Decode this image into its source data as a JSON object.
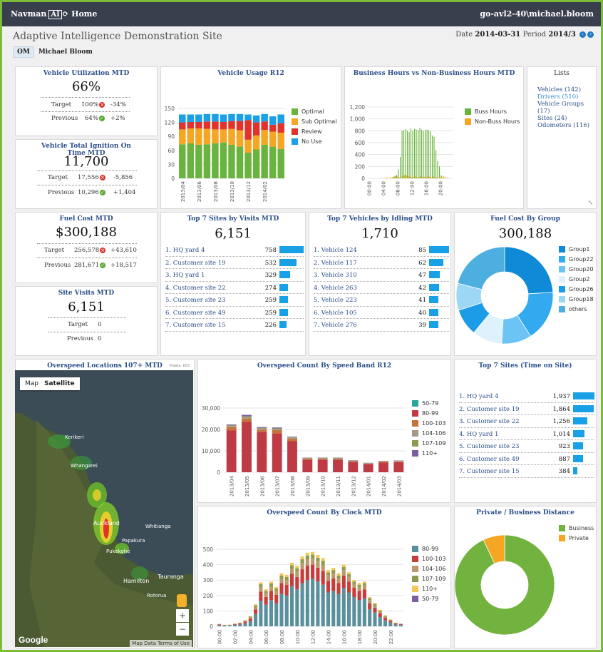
{
  "topbar": {
    "brand": "Navman",
    "brand_ai": "AI",
    "home": "Home",
    "user": "go-avl2-40\\michael.bloom"
  },
  "site_title": "Adaptive Intelligence Demonstration Site",
  "period": {
    "date_label": "Date",
    "date": "2014-03-31",
    "period_label": "Period",
    "period": "2014/3"
  },
  "user_tag": "OM",
  "user_name": "Michael Bloom",
  "vehicle_util": {
    "title": "Vehicle Utilization MTD",
    "value": "66%",
    "target_label": "Target",
    "target": "100%",
    "target_diff": "-34%",
    "previous_label": "Previous",
    "previous": "64%",
    "previous_diff": "+2%"
  },
  "ignition": {
    "title": "Vehicle Total Ignition On Time MTD",
    "value": "11,700",
    "target_label": "Target",
    "target": "17,556",
    "target_diff": "-5,856",
    "previous_label": "Previous",
    "previous": "10,296",
    "previous_diff": "+1,404"
  },
  "fuel_cost": {
    "title": "Fuel Cost MTD",
    "value": "$300,188",
    "target_label": "Target",
    "target": "256,578",
    "target_diff": "+43,610",
    "previous_label": "Previous",
    "previous": "281,671",
    "previous_diff": "+18,517"
  },
  "site_visits": {
    "title": "Site Visits MTD",
    "value": "6,151",
    "target_label": "Target",
    "target": "0",
    "previous_label": "Previous",
    "previous": "0"
  },
  "lists": {
    "title": "Lists",
    "items": [
      "Vehicles (142)",
      "Drivers (510)",
      "Vehicle Groups (17)",
      "Sites (24)",
      "Odometers (116)"
    ]
  },
  "top_sites_visits": {
    "title": "Top 7 Sites by Visits MTD",
    "total": "6,151",
    "rows": [
      {
        "name": "1. HQ yard 4",
        "value": "758",
        "frac": 1.0
      },
      {
        "name": "2. Customer site 19",
        "value": "532",
        "frac": 0.7
      },
      {
        "name": "3. HQ yard 1",
        "value": "329",
        "frac": 0.43
      },
      {
        "name": "4. Customer site 22",
        "value": "274",
        "frac": 0.36
      },
      {
        "name": "5. Customer site 23",
        "value": "259",
        "frac": 0.34
      },
      {
        "name": "6. Customer site 49",
        "value": "259",
        "frac": 0.34
      },
      {
        "name": "7. Customer site 15",
        "value": "226",
        "frac": 0.3
      }
    ]
  },
  "top_idling": {
    "title": "Top 7 Vehicles by Idling MTD",
    "total": "1,710",
    "rows": [
      {
        "name": "1. Vehicle 124",
        "value": "85",
        "frac": 1.0
      },
      {
        "name": "2. Vehicle 117",
        "value": "62",
        "frac": 0.73
      },
      {
        "name": "3. Vehicle 310",
        "value": "47",
        "frac": 0.55
      },
      {
        "name": "4. Vehicle 263",
        "value": "42",
        "frac": 0.49
      },
      {
        "name": "5. Vehicle 223",
        "value": "41",
        "frac": 0.48
      },
      {
        "name": "6. Vehicle 105",
        "value": "40",
        "frac": 0.47
      },
      {
        "name": "7. Vehicle 276",
        "value": "39",
        "frac": 0.46
      }
    ]
  },
  "top_time_on_site": {
    "title": "Top 7 Sites (Time on Site)",
    "rows": [
      {
        "name": "1. HQ yard 4",
        "value": "1,937",
        "frac": 1.0
      },
      {
        "name": "2. Customer site 19",
        "value": "1,864",
        "frac": 0.96
      },
      {
        "name": "3. Customer site 22",
        "value": "1,256",
        "frac": 0.65
      },
      {
        "name": "4. HQ yard 1",
        "value": "1,014",
        "frac": 0.52
      },
      {
        "name": "5. Customer site 23",
        "value": "923",
        "frac": 0.48
      },
      {
        "name": "6. Customer site 49",
        "value": "887",
        "frac": 0.46
      },
      {
        "name": "7. Customer site 15",
        "value": "384",
        "frac": 0.2
      }
    ]
  },
  "map": {
    "title": "Overspeed Locations 107+ MTD",
    "points": "Points: 653",
    "btn_map": "Map",
    "btn_sat": "Satellite",
    "google": "Google",
    "footer": "Map Data  Terms of Use",
    "places": [
      "Kerikeri",
      "Whangarei",
      "Auckland",
      "Whitianga",
      "Papakura",
      "Pukekohe",
      "Tauranga",
      "Hamilton",
      "Rotorua"
    ]
  },
  "chart_data": [
    {
      "id": "usage",
      "type": "bar",
      "title": "Vehicle Usage R12",
      "categories": [
        "2013/04",
        "2013/05",
        "2013/06",
        "2013/07",
        "2013/08",
        "2013/09",
        "2013/10",
        "2013/11",
        "2013/12",
        "2014/01",
        "2014/02",
        "2014/03",
        "2014/04"
      ],
      "x_tick_labels": [
        "2013/04",
        "2013/06",
        "2013/08",
        "2013/10",
        "2013/12",
        "2014/02"
      ],
      "ylim": [
        0,
        150
      ],
      "yticks": [
        0,
        30,
        60,
        90,
        120,
        150
      ],
      "colors": [
        "#6ab33e",
        "#f5a623",
        "#e0332c",
        "#1aa0e6"
      ],
      "series": [
        {
          "name": "Optimal",
          "values": [
            73,
            75,
            72,
            73,
            75,
            77,
            72,
            68,
            55,
            62,
            72,
            68,
            63
          ]
        },
        {
          "name": "Sub Optimal",
          "values": [
            32,
            32,
            35,
            33,
            30,
            28,
            34,
            35,
            28,
            30,
            32,
            32,
            35
          ]
        },
        {
          "name": "Review",
          "values": [
            15,
            14,
            14,
            16,
            17,
            16,
            17,
            20,
            42,
            28,
            18,
            15,
            20
          ]
        },
        {
          "name": "No Use",
          "values": [
            17,
            16,
            16,
            16,
            16,
            16,
            15,
            15,
            12,
            15,
            16,
            18,
            19
          ]
        }
      ]
    },
    {
      "id": "hours",
      "type": "bar",
      "title": "Business Hours vs Non-Business Hours MTD",
      "ylim": [
        0,
        1200
      ],
      "yticks": [
        0,
        200,
        400,
        600,
        800,
        1000,
        1200
      ],
      "xticks": [
        "00:00",
        "04:00",
        "08:00",
        "12:00",
        "16:00",
        "20:00"
      ],
      "colors": [
        "#6ab33e",
        "#f5a623"
      ],
      "series": [
        {
          "name": "Buss Hours",
          "values": [
            0,
            0,
            0,
            0,
            0,
            0,
            0,
            0,
            0,
            0,
            0,
            0,
            0,
            0,
            20,
            40,
            60,
            150,
            360,
            800,
            810,
            830,
            800,
            780,
            840,
            800,
            830,
            820,
            810,
            850,
            820,
            800,
            810,
            820,
            810,
            790,
            720,
            700,
            480,
            290,
            200,
            50,
            0,
            0,
            0,
            0,
            0,
            0
          ]
        },
        {
          "name": "Non-Buss Hours",
          "values": [
            0,
            0,
            0,
            0,
            0,
            0,
            0,
            0,
            5,
            10,
            20,
            10,
            20,
            20,
            30,
            40,
            30,
            20,
            10,
            40,
            60,
            50,
            40,
            30,
            20,
            20,
            30,
            20,
            20,
            40,
            20,
            30,
            20,
            30,
            30,
            20,
            30,
            20,
            20,
            10,
            10,
            30,
            40,
            20,
            10,
            0,
            0,
            0
          ]
        }
      ]
    },
    {
      "id": "fuelgroup",
      "type": "pie",
      "title": "Fuel Cost By Group",
      "total": "300,188",
      "labels": [
        "Group1",
        "Group22",
        "Group20",
        "Group2",
        "Group26",
        "Group18",
        "others"
      ],
      "values": [
        24,
        17,
        10,
        10,
        9,
        9,
        21
      ],
      "colors": [
        "#0f8ad6",
        "#33aaf0",
        "#6cc4f5",
        "#dff1fc",
        "#1c9be6",
        "#9cd8f6",
        "#4daee0"
      ]
    },
    {
      "id": "speedband",
      "type": "bar",
      "title": "Overspeed Count By Speed Band R12",
      "categories": [
        "2013/04",
        "2013/05",
        "2013/06",
        "2013/07",
        "2013/08",
        "2013/09",
        "2013/10",
        "2013/11",
        "2013/12",
        "2014/01",
        "2014/02",
        "2014/03"
      ],
      "ylim": [
        0,
        30000
      ],
      "yticks": [
        "0",
        "10,000",
        "20,000",
        "30,000"
      ],
      "colors": [
        "#2aa39a",
        "#be3b46",
        "#c6743b",
        "#a59a8a",
        "#8e9a4e",
        "#7b5fa0"
      ],
      "series": [
        {
          "name": "50-79",
          "values": [
            0,
            0,
            0,
            0,
            0,
            0,
            0,
            0,
            0,
            0,
            0,
            0
          ]
        },
        {
          "name": "80-99",
          "values": [
            19500,
            23500,
            18800,
            18000,
            14500,
            5800,
            5800,
            5800,
            4800,
            3700,
            4500,
            4700
          ]
        },
        {
          "name": "100-103",
          "values": [
            1600,
            1600,
            1100,
            1700,
            1200,
            500,
            500,
            500,
            400,
            300,
            400,
            400
          ]
        },
        {
          "name": "104-106",
          "values": [
            500,
            600,
            500,
            500,
            400,
            200,
            200,
            200,
            150,
            150,
            150,
            150
          ]
        },
        {
          "name": "107-109",
          "values": [
            300,
            400,
            300,
            300,
            200,
            100,
            100,
            100,
            100,
            100,
            100,
            100
          ]
        },
        {
          "name": "110+",
          "values": [
            400,
            700,
            400,
            400,
            300,
            200,
            200,
            200,
            150,
            150,
            150,
            150
          ]
        }
      ]
    },
    {
      "id": "clock",
      "type": "bar",
      "title": "Overspeed Count By Clock MTD",
      "ylim": [
        0,
        500
      ],
      "yticks": [
        0,
        100,
        200,
        300,
        400,
        500
      ],
      "xticks": [
        "00:00",
        "02:00",
        "04:00",
        "06:00",
        "08:00",
        "10:00",
        "12:00",
        "14:00",
        "16:00",
        "18:00",
        "20:00",
        "22:00"
      ],
      "colors": [
        "#5a8f9c",
        "#c83c3c",
        "#ba9a6a",
        "#8e9a4e",
        "#f2c85b",
        "#7b5fa0"
      ],
      "series": [
        {
          "name": "80-99",
          "values": [
            8,
            5,
            6,
            10,
            12,
            20,
            35,
            80,
            165,
            140,
            170,
            150,
            210,
            200,
            260,
            240,
            280,
            300,
            310,
            290,
            270,
            220,
            230,
            210,
            250,
            220,
            190,
            170,
            180,
            110,
            90,
            60,
            40,
            25,
            12,
            10
          ]
        },
        {
          "name": "100-103",
          "values": [
            4,
            2,
            2,
            4,
            6,
            10,
            15,
            30,
            60,
            50,
            60,
            55,
            70,
            70,
            80,
            80,
            90,
            95,
            90,
            90,
            90,
            75,
            80,
            70,
            80,
            70,
            60,
            60,
            60,
            40,
            30,
            25,
            15,
            10,
            6,
            4
          ]
        },
        {
          "name": "104-106",
          "values": [
            2,
            1,
            1,
            2,
            3,
            5,
            8,
            15,
            30,
            25,
            30,
            25,
            30,
            30,
            35,
            35,
            40,
            40,
            40,
            40,
            40,
            35,
            35,
            30,
            35,
            30,
            25,
            25,
            25,
            20,
            15,
            10,
            8,
            5,
            3,
            2
          ]
        },
        {
          "name": "107-109",
          "values": [
            1,
            1,
            1,
            1,
            2,
            3,
            5,
            10,
            18,
            15,
            18,
            15,
            20,
            20,
            22,
            22,
            25,
            25,
            25,
            25,
            25,
            20,
            20,
            20,
            20,
            18,
            15,
            15,
            15,
            12,
            10,
            7,
            5,
            3,
            2,
            1
          ]
        },
        {
          "name": "110+",
          "values": [
            1,
            0,
            1,
            1,
            1,
            2,
            4,
            8,
            12,
            10,
            12,
            10,
            14,
            14,
            16,
            16,
            18,
            18,
            18,
            18,
            18,
            15,
            15,
            14,
            15,
            13,
            11,
            11,
            11,
            8,
            7,
            5,
            4,
            2,
            1,
            1
          ]
        },
        {
          "name": "50-79",
          "values": [
            0,
            0,
            0,
            0,
            0,
            0,
            0,
            0,
            0,
            0,
            0,
            0,
            0,
            0,
            0,
            0,
            0,
            0,
            0,
            0,
            0,
            0,
            0,
            0,
            0,
            0,
            0,
            0,
            0,
            0,
            0,
            0,
            0,
            0,
            0,
            0
          ]
        }
      ]
    },
    {
      "id": "private",
      "type": "pie",
      "title": "Private / Business Distance",
      "labels": [
        "Business",
        "Private"
      ],
      "values": [
        93,
        7
      ],
      "colors": [
        "#72b33f",
        "#f5a623"
      ]
    }
  ]
}
